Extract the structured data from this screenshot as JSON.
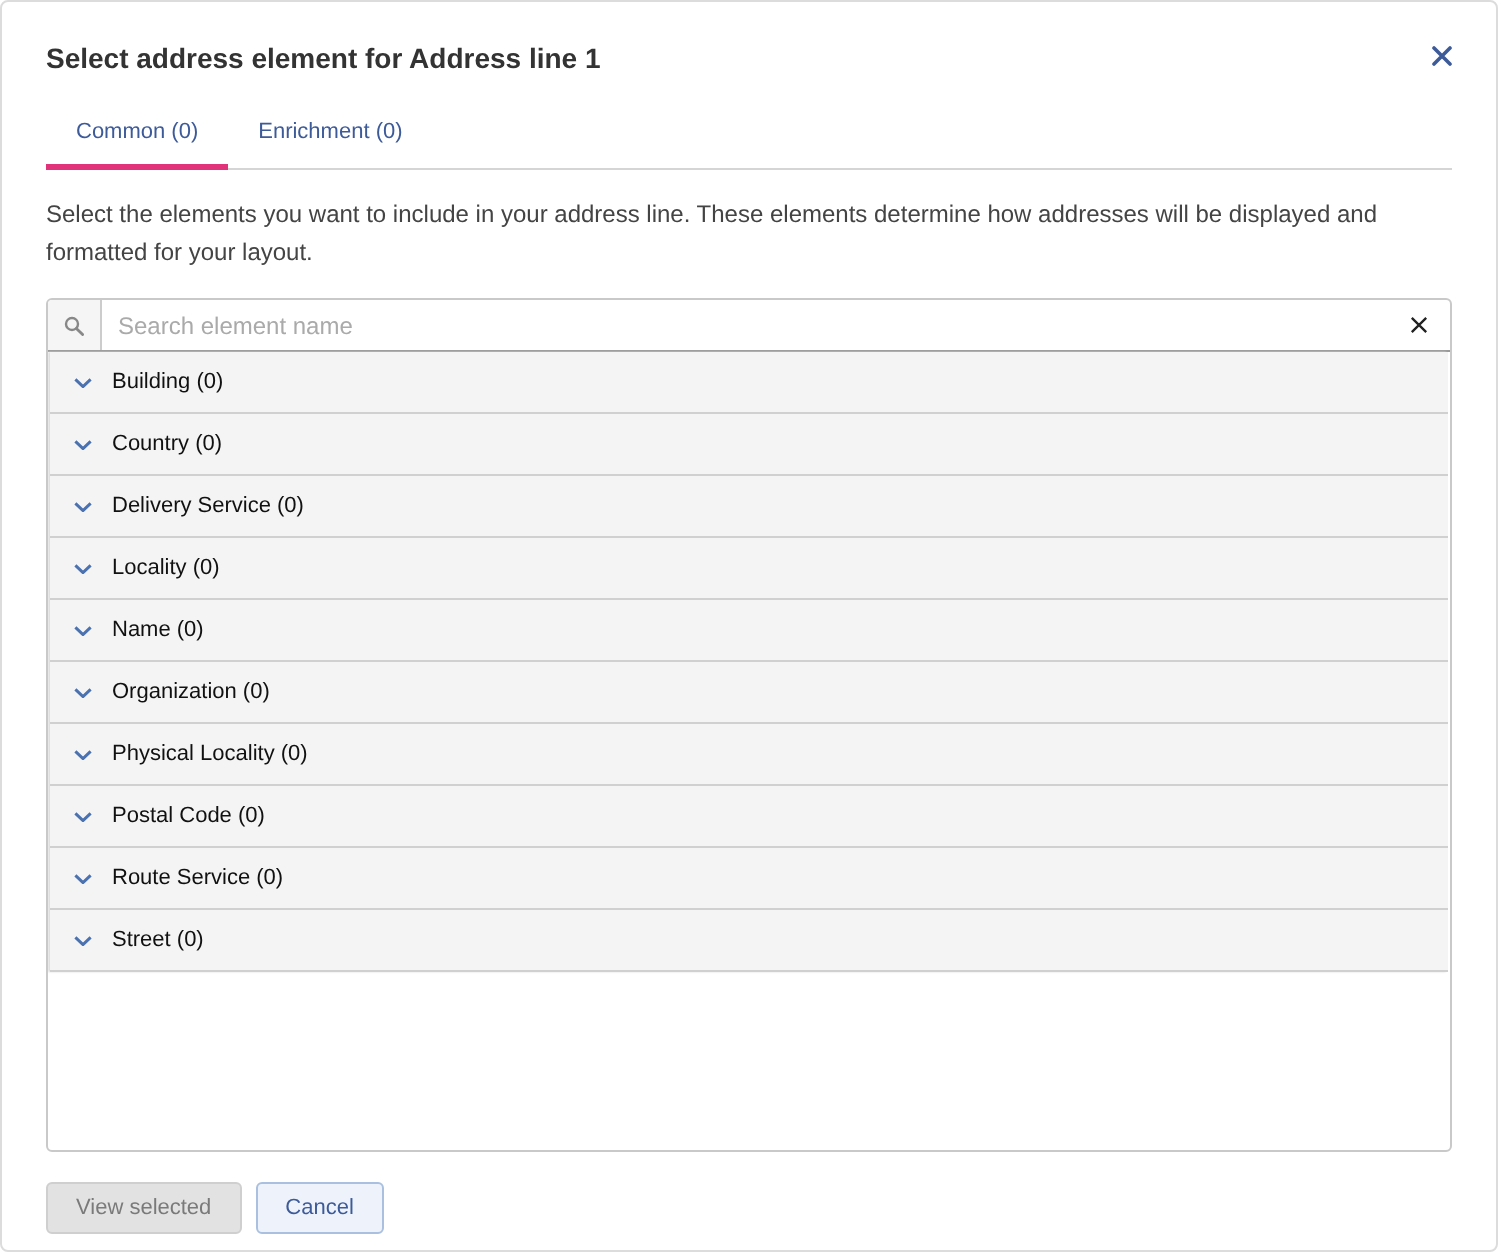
{
  "dialog": {
    "title": "Select address element for Address line 1"
  },
  "tabs": [
    {
      "label": "Common (0)",
      "selected": true
    },
    {
      "label": "Enrichment (0)",
      "selected": false
    }
  ],
  "description": "Select the elements you want to include in your address line. These elements determine how addresses will be displayed and formatted for your layout.",
  "search": {
    "placeholder": "Search element name"
  },
  "groups": [
    {
      "label": "Building (0)",
      "expanded": false
    },
    {
      "label": "Country (0)",
      "expanded": false
    },
    {
      "label": "Delivery Service (0)",
      "expanded": false
    },
    {
      "label": "Locality (0)",
      "expanded": false
    },
    {
      "label": "Name (0)",
      "expanded": false
    },
    {
      "label": "Organization (0)",
      "expanded": false
    },
    {
      "label": "Physical Locality (0)",
      "expanded": false
    },
    {
      "label": "Postal Code (0)",
      "expanded": false
    },
    {
      "label": "Route Service (0)",
      "expanded": false
    },
    {
      "label": "Street (0)",
      "expanded": false
    }
  ],
  "buttons": [
    {
      "label": "View selected",
      "disabled": true
    },
    {
      "label": "Cancel",
      "disabled": false
    }
  ]
}
